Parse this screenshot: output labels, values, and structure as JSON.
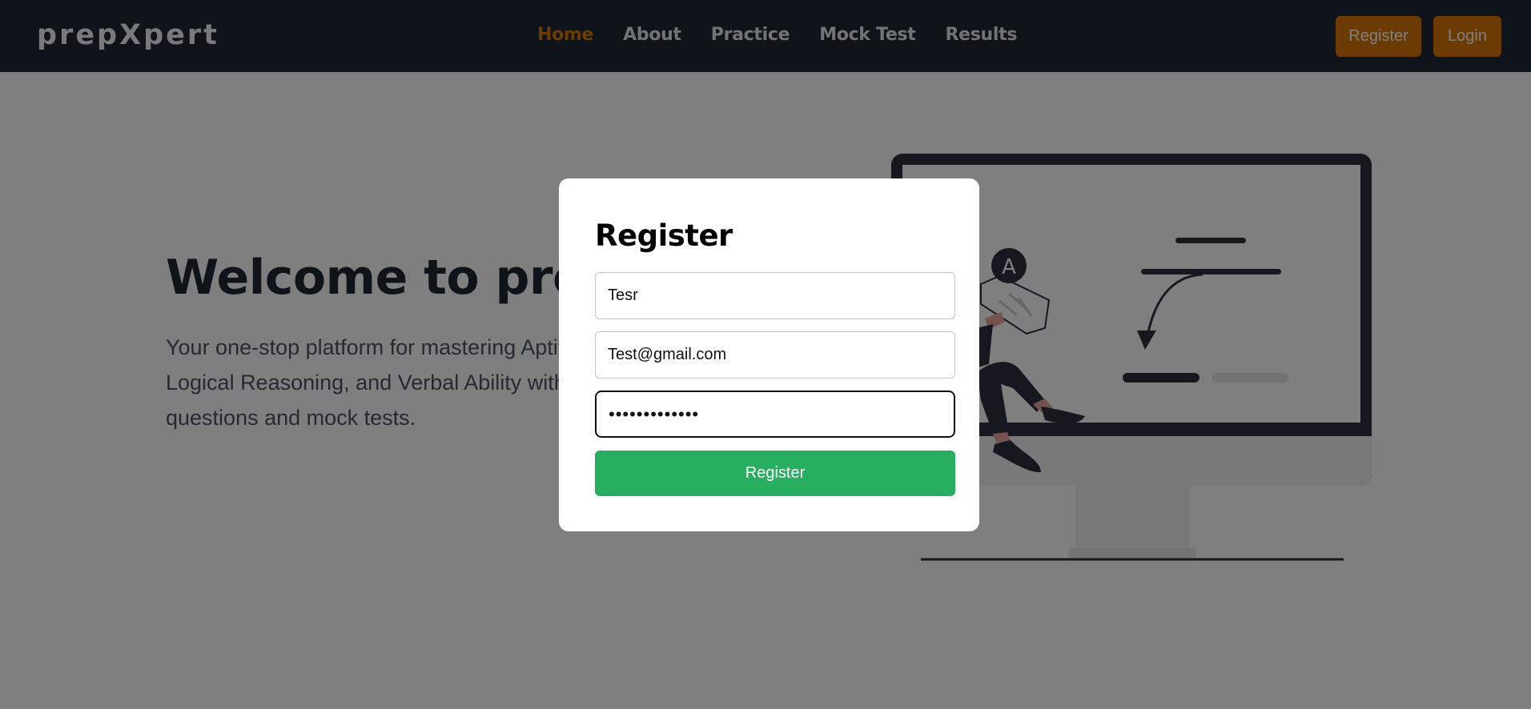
{
  "navbar": {
    "logo": "prepXpert",
    "links": [
      {
        "label": "Home",
        "active": true
      },
      {
        "label": "About",
        "active": false
      },
      {
        "label": "Practice",
        "active": false
      },
      {
        "label": "Mock Test",
        "active": false
      },
      {
        "label": "Results",
        "active": false
      }
    ],
    "register_label": "Register",
    "login_label": "Login"
  },
  "hero": {
    "title": "Welcome to prepXpert",
    "subtitle": "Your one-stop platform for mastering Aptitude, Logical Reasoning, and Verbal Ability with practice questions and mock tests."
  },
  "illustration": {
    "avatar_letter": "A"
  },
  "modal": {
    "title": "Register",
    "name_value": "Tesr",
    "email_value": "Test@gmail.com",
    "password_value": "•••••••••••••",
    "submit_label": "Register"
  },
  "colors": {
    "navbar_bg": "#1f2937",
    "accent": "#d97706",
    "submit_green": "#27ae60",
    "overlay": "rgba(0,0,0,0.5)"
  }
}
